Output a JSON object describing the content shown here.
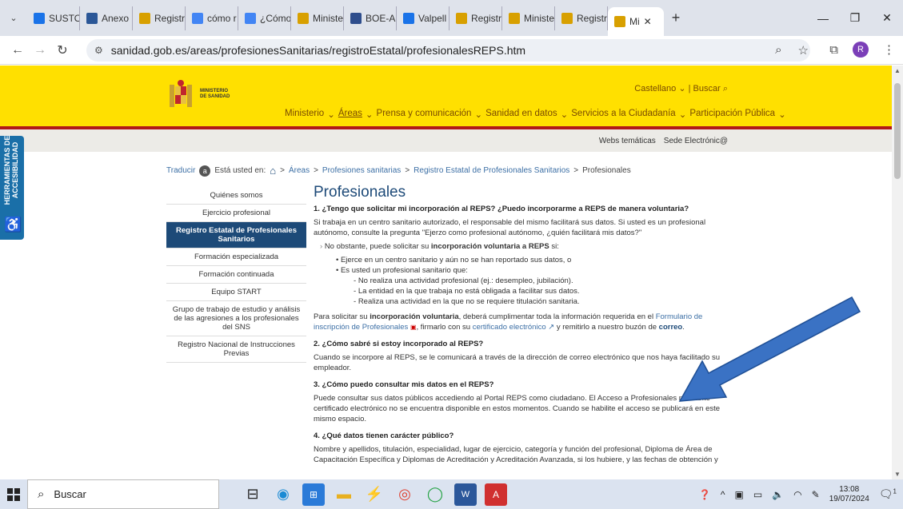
{
  "browser": {
    "tabs": [
      {
        "label": "SUSTO",
        "color": "#1a73e8"
      },
      {
        "label": "Anexo",
        "color": "#2b5797"
      },
      {
        "label": "Registr",
        "color": "#d8a000"
      },
      {
        "label": "cómo r",
        "color": "#4285f4"
      },
      {
        "label": "¿Cómo",
        "color": "#4285f4"
      },
      {
        "label": "Ministe",
        "color": "#d8a000"
      },
      {
        "label": "BOE-A",
        "color": "#2e4d8c"
      },
      {
        "label": "Valpell",
        "color": "#1a73e8"
      },
      {
        "label": "Registr",
        "color": "#d8a000"
      },
      {
        "label": "Ministe",
        "color": "#d8a000"
      },
      {
        "label": "Registr",
        "color": "#d8a000"
      },
      {
        "label": "Mi",
        "color": "#d8a000"
      }
    ],
    "url": "sanidad.gob.es/areas/profesionesSanitarias/registroEstatal/profesionalesREPS.htm",
    "avatar_letter": "R"
  },
  "header": {
    "logo_line1": "MINISTERIO",
    "logo_line2": "DE SANIDAD",
    "language": "Castellano",
    "search": "Buscar",
    "nav": [
      "Ministerio",
      "Áreas",
      "Prensa y comunicación",
      "Sanidad en datos",
      "Servicios a la Ciudadanía",
      "Participación Pública"
    ]
  },
  "subbar": {
    "link1": "Webs temáticas",
    "link2": "Sede Electrónic@"
  },
  "accessibility": {
    "label": "HERRAMIENTAS DE ACCESIBILIDAD"
  },
  "breadcrumb": {
    "translate": "Traducir",
    "prefix": "Está usted en:",
    "items": [
      "Áreas",
      "Profesiones sanitarias",
      "Registro Estatal de Profesionales Sanitarios"
    ],
    "current": "Profesionales"
  },
  "sidemenu": [
    "Quiénes somos",
    "Ejercicio profesional",
    "Registro Estatal de Profesionales Sanitarios",
    "Formación especializada",
    "Formación continuada",
    "Equipo START",
    "Grupo de trabajo de estudio y análisis de las agresiones a los profesionales del SNS",
    "Registro Nacional de Instrucciones Previas"
  ],
  "content": {
    "title": "Profesionales",
    "q1": "1. ¿Tengo que solicitar mi incorporación al REPS? ¿Puedo incorporarme a REPS de manera voluntaria?",
    "p1": "Si trabaja en un centro sanitario autorizado, el responsable del mismo facilitará sus datos. Si usted es un profesional autónomo, consulte la pregunta \"Ejerzo como profesional autónomo, ¿quién facilitará mis datos?\"",
    "p2a": "No obstante, puede solicitar su ",
    "p2b": "incorporación voluntaria a REPS",
    "p2c": " si:",
    "li1": "Ejerce en un centro sanitario y aún no se han reportado sus datos, o",
    "li2": "Es usted un profesional sanitario que:",
    "dash1": "No realiza una actividad profesional (ej.: desempleo, jubilación).",
    "dash2": "La entidad en la que trabaja no está obligada a facilitar sus datos.",
    "dash3": "Realiza una actividad en la que no se requiere titulación sanitaria.",
    "p3a": "Para solicitar su ",
    "p3b": "incorporación voluntaria",
    "p3c": ", deberá cumplimentar toda la información requerida en el ",
    "p3link1": "Formulario de inscripción de Profesionales",
    "p3d": ", firmarlo con su ",
    "p3link2": "certificado electrónico",
    "p3e": " y remitirlo a nuestro buzón de ",
    "p3link3": "correo",
    "p3f": ".",
    "q2": "2. ¿Cómo sabré si estoy incorporado al REPS?",
    "p4": "Cuando se incorpore al REPS, se le comunicará a través de la dirección de correo electrónico que nos haya facilitado su empleador.",
    "q3": "3. ¿Cómo puedo consultar mis datos en el REPS?",
    "p5": "Puede consultar sus datos públicos accediendo al Portal REPS como ciudadano. El Acceso a Profesionales mediante certificado electrónico no se encuentra disponible en estos momentos. Cuando se habilite el acceso se publicará en este mismo espacio.",
    "q4": "4. ¿Qué datos tienen carácter público?",
    "p6": "Nombre y apellidos, titulación, especialidad, lugar de ejercicio, categoría y función del profesional, Diploma de Área de Capacitación Específica y Diplomas de Acreditación y Acreditación Avanzada, si los hubiere, y las fechas de obtención y"
  },
  "taskbar": {
    "search": "Buscar",
    "time": "13:08",
    "date": "19/07/2024",
    "notifications": "1"
  },
  "colors": {
    "header_yellow": "#ffe000",
    "header_red": "#b01818",
    "menu_active": "#1d4a78",
    "arrow_blue": "#3a72c4"
  }
}
